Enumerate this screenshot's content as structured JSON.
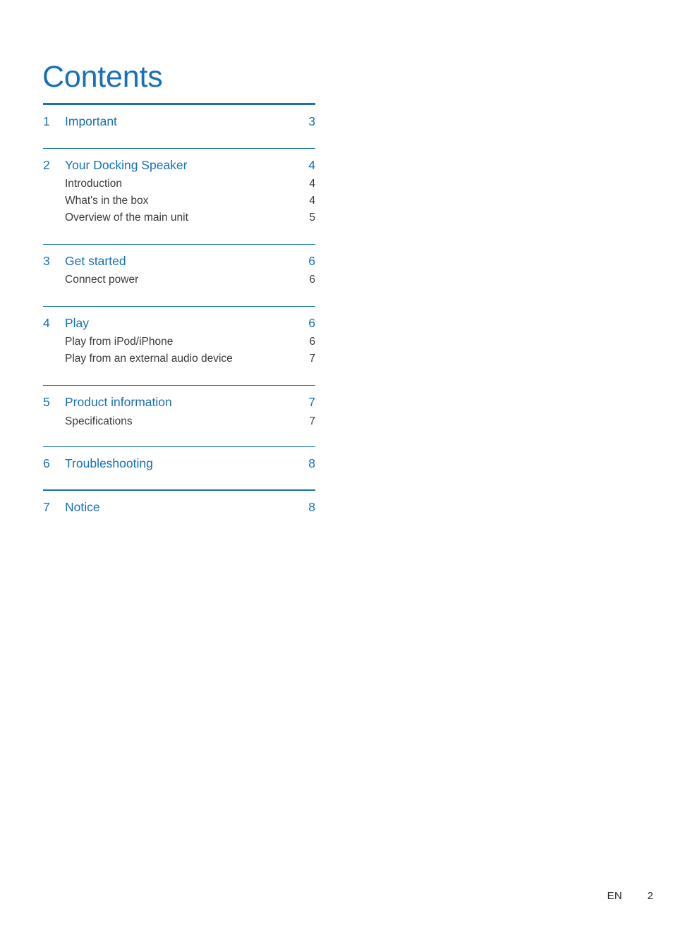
{
  "document": {
    "title": "Contents"
  },
  "toc": {
    "sections": [
      {
        "number": "1",
        "title": "Important",
        "page": "3",
        "rule": "thick",
        "subitems": []
      },
      {
        "number": "2",
        "title": "Your Docking Speaker",
        "page": "4",
        "rule": "thin",
        "subitems": [
          {
            "title": "Introduction",
            "page": "4"
          },
          {
            "title": "What's in the box",
            "page": "4"
          },
          {
            "title": "Overview of the main unit",
            "page": "5"
          }
        ]
      },
      {
        "number": "3",
        "title": "Get started",
        "page": "6",
        "rule": "thin",
        "subitems": [
          {
            "title": "Connect power",
            "page": "6"
          }
        ]
      },
      {
        "number": "4",
        "title": "Play",
        "page": "6",
        "rule": "thin",
        "subitems": [
          {
            "title": "Play from iPod/iPhone",
            "page": "6"
          },
          {
            "title": "Play from an external audio device",
            "page": "7"
          }
        ]
      },
      {
        "number": "5",
        "title": "Product information",
        "page": "7",
        "rule": "thin",
        "subitems": [
          {
            "title": "Specifications",
            "page": "7"
          }
        ]
      },
      {
        "number": "6",
        "title": "Troubleshooting",
        "page": "8",
        "rule": "thin",
        "subitems": []
      },
      {
        "number": "7",
        "title": "Notice",
        "page": "8",
        "rule": "thin",
        "subitems": []
      }
    ]
  },
  "footer": {
    "language": "EN",
    "page_number": "2"
  },
  "colors": {
    "accent_blue": "#1770b8",
    "body_text": "#3a3a3a",
    "footer_text": "#2b2b2b",
    "background": "#ffffff"
  }
}
